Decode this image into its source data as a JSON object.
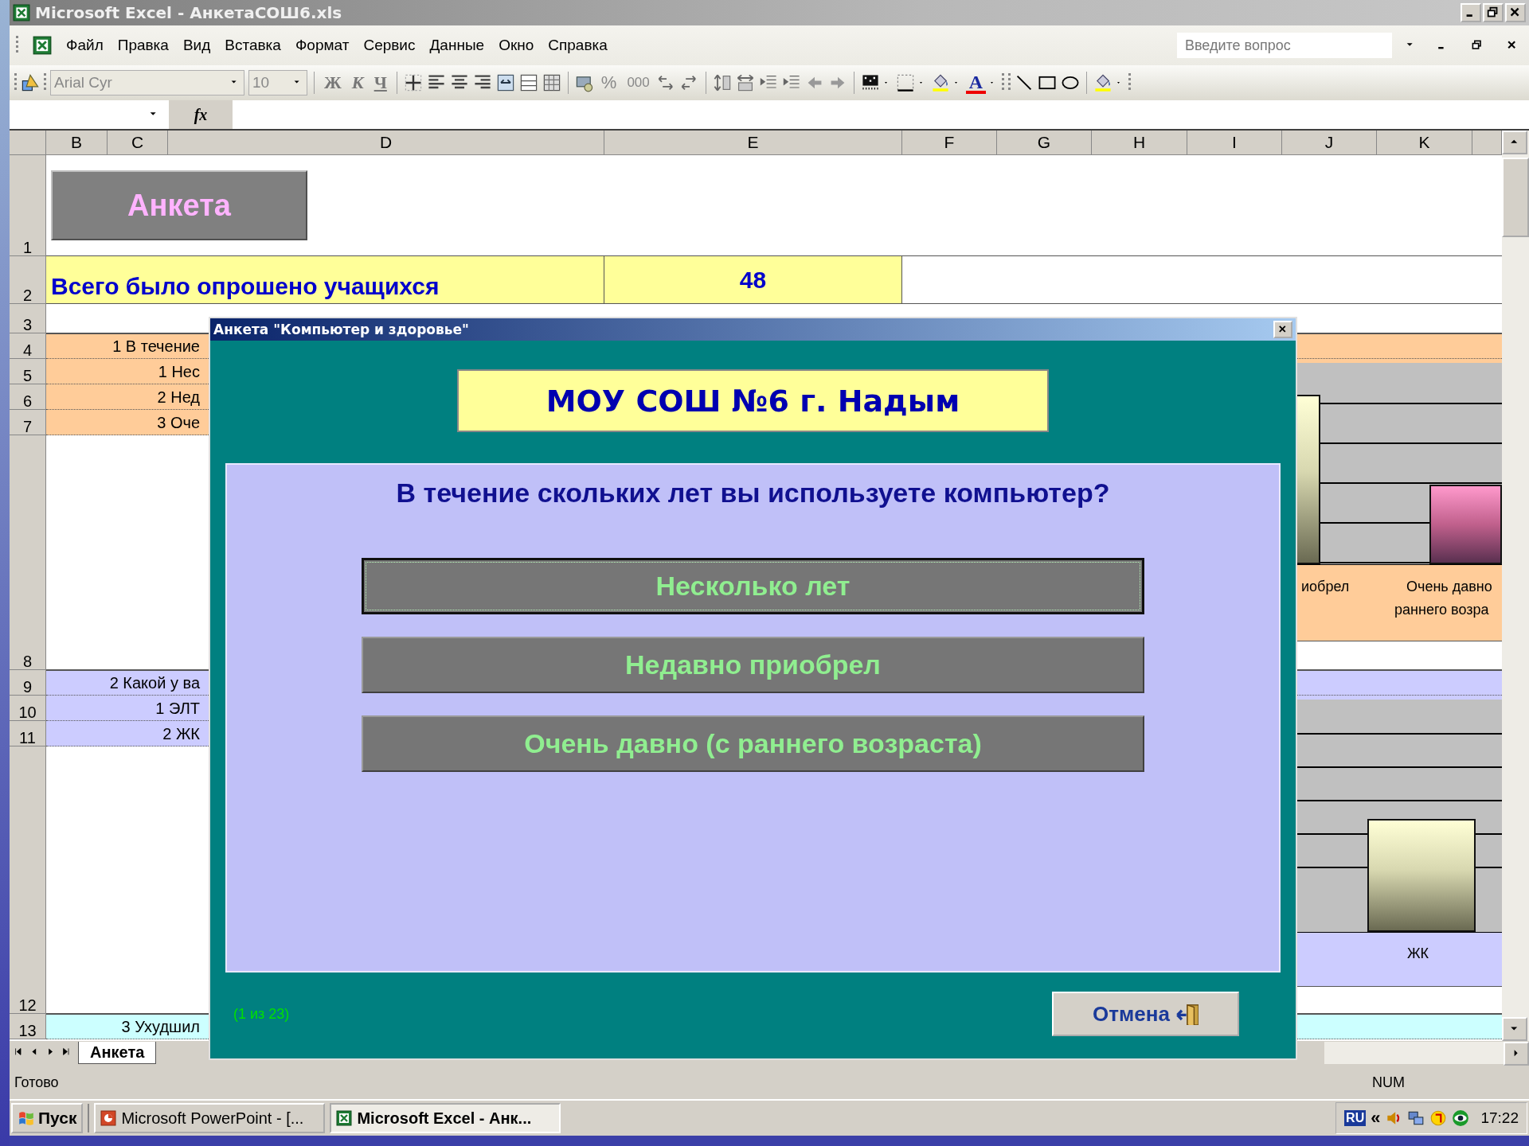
{
  "window": {
    "title": "Microsoft Excel - АнкетаСОШ6.xls"
  },
  "menu": [
    {
      "label": "Файл"
    },
    {
      "label": "Правка"
    },
    {
      "label": "Вид"
    },
    {
      "label": "Вставка"
    },
    {
      "label": "Формат"
    },
    {
      "label": "Сервис"
    },
    {
      "label": "Данные"
    },
    {
      "label": "Окно"
    },
    {
      "label": "Справка"
    }
  ],
  "help_search": {
    "placeholder": "Введите вопрос"
  },
  "toolbar": {
    "font": "Arial Cyr",
    "size": "10",
    "bold": "Ж",
    "italic": "К",
    "underline": "Ч",
    "percent": "%",
    "thousands": "000",
    "font_color": "A"
  },
  "formula_bar": {
    "fx": "fx"
  },
  "columns": [
    "B",
    "C",
    "D",
    "E",
    "F",
    "G",
    "H",
    "I",
    "J",
    "K"
  ],
  "rows": [
    {
      "number": "1",
      "kind": "title",
      "text": "Анкета"
    },
    {
      "number": "2",
      "kind": "total",
      "text": "Всего было опрошено учащихся",
      "value": "48"
    },
    {
      "number": "3",
      "kind": "blank"
    },
    {
      "number": "4",
      "kind": "question",
      "text": "1 В течение",
      "color": "#ffcc99"
    },
    {
      "number": "5",
      "kind": "answer",
      "text": "1 Нес",
      "color": "#ffcc99"
    },
    {
      "number": "6",
      "kind": "answer",
      "text": "2 Нед",
      "color": "#ffcc99"
    },
    {
      "number": "7",
      "kind": "answer",
      "text": "3 Оче",
      "color": "#ffcc99"
    },
    {
      "number": "8",
      "kind": "blank"
    },
    {
      "number": "9",
      "kind": "question",
      "text": "2 Какой у ва",
      "color": "#ccccff"
    },
    {
      "number": "10",
      "kind": "answer",
      "text": "1 ЭЛТ",
      "color": "#ccccff"
    },
    {
      "number": "11",
      "kind": "answer",
      "text": "2 ЖК",
      "color": "#ccccff"
    },
    {
      "number": "12",
      "kind": "blank"
    },
    {
      "number": "13",
      "kind": "question",
      "text": "3 Ухудшил",
      "color": "#ccffff"
    }
  ],
  "charts": [
    {
      "labels": [
        "иобрел",
        "Очень давно",
        "раннего возра"
      ]
    },
    {
      "labels": [
        "ЖК"
      ]
    }
  ],
  "sheet_tabs": [
    {
      "label": "Анкета",
      "selected": true
    }
  ],
  "dialog": {
    "title": "Анкета \"Компьютер и здоровье\"",
    "header": "МОУ СОШ №6 г. Надым",
    "question": "В течение скольких лет вы используете компьютер?",
    "options": [
      {
        "label": "Несколько лет",
        "focused": true
      },
      {
        "label": "Недавно приобрел",
        "focused": false
      },
      {
        "label": "Очень давно (с раннего возраста)",
        "focused": false
      }
    ],
    "progress": "(1 из 23)",
    "cancel": "Отмена"
  },
  "status_bar": {
    "text": "Готово",
    "num": "NUM"
  },
  "taskbar": {
    "start": "Пуск",
    "buttons": [
      {
        "label": "Microsoft PowerPoint - [...",
        "kind": "powerpoint",
        "selected": false
      },
      {
        "label": "Microsoft Excel - Анк...",
        "kind": "excel",
        "selected": true
      }
    ],
    "language": "RU",
    "expand": "«",
    "clock": "17:22"
  }
}
